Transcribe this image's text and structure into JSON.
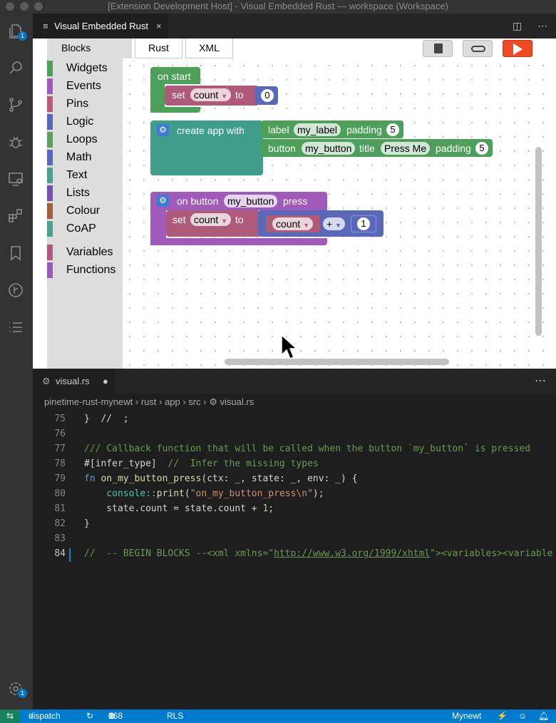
{
  "window": {
    "title": "[Extension Development Host] - Visual Embedded Rust — workspace (Workspace)"
  },
  "activity": {
    "explorer_badge": "1",
    "settings_badge": "1"
  },
  "editor_tab": {
    "label": "Visual Embedded Rust"
  },
  "webview": {
    "blocks_tab": "Blocks",
    "tabs": [
      "Rust",
      "XML"
    ],
    "categories": [
      {
        "label": "Widgets",
        "color": "#4ca05a"
      },
      {
        "label": "Events",
        "color": "#a05ab9"
      },
      {
        "label": "Pins",
        "color": "#b95a78"
      },
      {
        "label": "Logic",
        "color": "#5a68b9"
      },
      {
        "label": "Loops",
        "color": "#5aa05a"
      },
      {
        "label": "Math",
        "color": "#5a68b9"
      },
      {
        "label": "Text",
        "color": "#4ca08c"
      },
      {
        "label": "Lists",
        "color": "#7452b0"
      },
      {
        "label": "Colour",
        "color": "#a06040"
      },
      {
        "label": "CoAP",
        "color": "#4ca08c"
      },
      {
        "label": "Variables",
        "color": "#b05a80"
      },
      {
        "label": "Functions",
        "color": "#9a5ab9"
      }
    ],
    "block1": {
      "title": "on start",
      "set": "set",
      "var": "count",
      "to": "to",
      "value": "0"
    },
    "block2": {
      "title": "create app with",
      "row1": {
        "kw": "label",
        "name": "my_label",
        "pad_kw": "padding",
        "pad": "5"
      },
      "row2": {
        "kw": "button",
        "name": "my_button",
        "title_kw": "title",
        "title": "Press Me",
        "pad_kw": "padding",
        "pad": "5"
      }
    },
    "block3": {
      "pre": "on button",
      "name": "my_button",
      "post": "press",
      "set": "set",
      "var": "count",
      "to": "to",
      "inner_var": "count",
      "op": "+",
      "value": "1"
    }
  },
  "code_editor": {
    "tab": "visual.rs",
    "breadcrumb": [
      "pinetime-rust-mynewt",
      "rust",
      "app",
      "src",
      "visual.rs"
    ],
    "line_numbers": [
      "75",
      "76",
      "77",
      "78",
      "79",
      "80",
      "81",
      "82",
      "83",
      "84"
    ],
    "lines": {
      "l75": "}  //  ;",
      "l77": "/// Callback function that will be called when the button `my_button` is pressed",
      "l78a": "#[infer_type]",
      "l78b": "  //  Infer the missing types",
      "l79a": "fn ",
      "l79b": "on_my_button_press",
      "l79c": "(ctx: _, state: _, env: _) {",
      "l80a": "    console::",
      "l80b": "print",
      "l80c": "(",
      "l80d": "\"on_my_button_press\\n\"",
      "l80e": ");",
      "l81a": "    state.count = state.count + ",
      "l81b": "1",
      "l81c": ";",
      "l82": "}",
      "l84a": "//  -- BEGIN BLOCKS --<xml xmlns=\"",
      "l84b": "http://www.w3.org/1999/xhtml",
      "l84c": "\"><variables><variable"
    }
  },
  "status": {
    "branch": "dispatch",
    "errors": "0",
    "warnings": "168",
    "rls": "RLS",
    "target": "Mynewt"
  }
}
